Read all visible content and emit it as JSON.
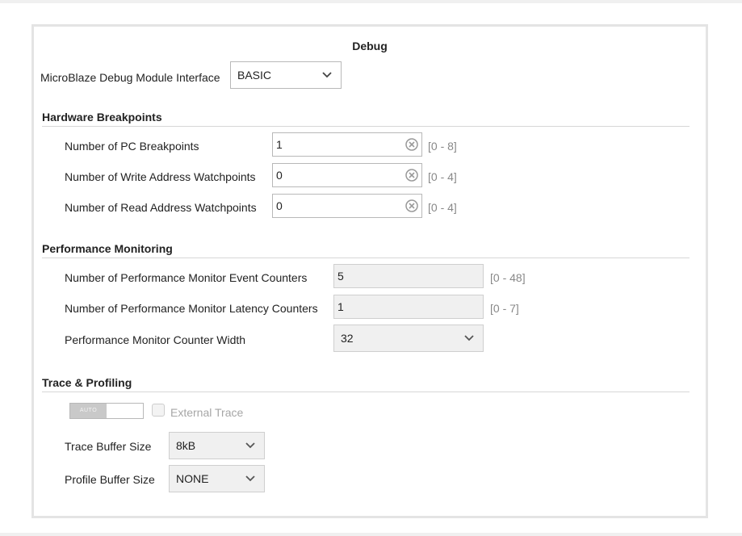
{
  "title": "Debug",
  "mdm": {
    "label": "MicroBlaze Debug Module Interface",
    "value": "BASIC"
  },
  "hw": {
    "heading": "Hardware Breakpoints",
    "pc": {
      "label": "Number of PC Breakpoints",
      "value": "1",
      "range": "[0 - 8]"
    },
    "write": {
      "label": "Number of Write Address Watchpoints",
      "value": "0",
      "range": "[0 - 4]"
    },
    "read": {
      "label": "Number of Read Address Watchpoints",
      "value": "0",
      "range": "[0 - 4]"
    }
  },
  "perf": {
    "heading": "Performance Monitoring",
    "event": {
      "label": "Number of Performance Monitor Event Counters",
      "value": "5",
      "range": "[0 - 48]"
    },
    "latency": {
      "label": "Number of Performance Monitor Latency Counters",
      "value": "1",
      "range": "[0 - 7]"
    },
    "width": {
      "label": "Performance Monitor Counter Width",
      "value": "32"
    }
  },
  "trace": {
    "heading": "Trace & Profiling",
    "toggle_label": "AUTO",
    "external_label": "External Trace",
    "buffer": {
      "label": "Trace Buffer Size",
      "value": "8kB"
    },
    "profile": {
      "label": "Profile Buffer Size",
      "value": "NONE"
    }
  },
  "icons": {
    "clear": "clear-circle-icon",
    "dropdown": "chevron-down-icon"
  },
  "colors": {
    "panel_border": "#e4e4e4",
    "range_text": "#888888",
    "disabled_bg": "#f0f0f0"
  }
}
